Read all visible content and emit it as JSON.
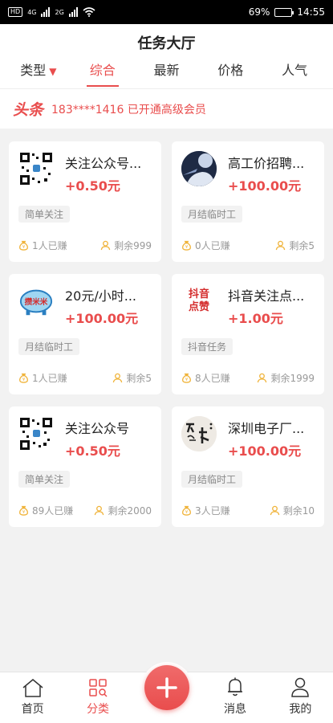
{
  "status_bar": {
    "signal_1": "4G",
    "signal_2": "2G",
    "battery": "69%",
    "time": "14:55"
  },
  "header": {
    "title": "任务大厅"
  },
  "tabs": [
    {
      "label": "类型"
    },
    {
      "label": "综合"
    },
    {
      "label": "最新"
    },
    {
      "label": "价格"
    },
    {
      "label": "人气"
    }
  ],
  "headline": {
    "tag": "头条",
    "text": "183****1416 已开通高级会员"
  },
  "tasks": [
    {
      "title": "关注公众号...",
      "price": "+0.50元",
      "tag": "简单关注",
      "earned": "1人已赚",
      "remaining": "剩余999",
      "thumb": "qr-code"
    },
    {
      "title": "高工价招聘...",
      "price": "+100.00元",
      "tag": "月结临时工",
      "earned": "0人已赚",
      "remaining": "剩余5",
      "thumb": "person-photo"
    },
    {
      "title": "20元/小时...",
      "price": "+100.00元",
      "tag": "月结临时工",
      "earned": "1人已赚",
      "remaining": "剩余5",
      "thumb": "piggy-logo",
      "thumb_text": "攒米米"
    },
    {
      "title": "抖音关注点...",
      "price": "+1.00元",
      "tag": "抖音任务",
      "earned": "8人已赚",
      "remaining": "剩余1999",
      "thumb": "douyin-text",
      "thumb_text_1": "抖音",
      "thumb_text_2": "点赞"
    },
    {
      "title": "关注公众号",
      "price": "+0.50元",
      "tag": "简单关注",
      "earned": "89人已赚",
      "remaining": "剩余2000",
      "thumb": "qr-code"
    },
    {
      "title": "深圳电子厂...",
      "price": "+100.00元",
      "tag": "月结临时工",
      "earned": "3人已赚",
      "remaining": "剩余10",
      "thumb": "calligraphy"
    }
  ],
  "tabbar": [
    {
      "label": "首页",
      "icon": "home-icon"
    },
    {
      "label": "分类",
      "icon": "category-icon"
    },
    {
      "label": "消息",
      "icon": "bell-icon"
    },
    {
      "label": "我的",
      "icon": "profile-icon"
    }
  ],
  "colors": {
    "accent": "#e94d4d",
    "bg": "#f2f2f2"
  }
}
